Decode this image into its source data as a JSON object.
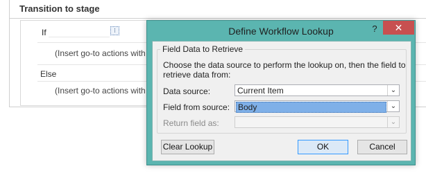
{
  "stage": {
    "title": "Transition to stage",
    "if_label": "If",
    "if_icon": "expression-builder-icon",
    "hint_if": "(Insert go-to actions with co",
    "else_label": "Else",
    "hint_else": "(Insert go-to actions with co"
  },
  "dialog": {
    "title": "Define Workflow Lookup",
    "help": "?",
    "close": "✕",
    "group_title": "Field Data to Retrieve",
    "instruction": "Choose the data source to perform the lookup on, then the field to retrieve data from:",
    "data_source_label": "Data source:",
    "data_source_value": "Current Item",
    "field_label": "Field from source:",
    "field_value": "Body",
    "return_label": "Return field as:",
    "return_value": "",
    "clear_button": "Clear Lookup",
    "ok_button": "OK",
    "cancel_button": "Cancel"
  },
  "colors": {
    "title_bar": "#5bb5b0",
    "close_button": "#c75050",
    "selection": "#7fb0e8"
  }
}
